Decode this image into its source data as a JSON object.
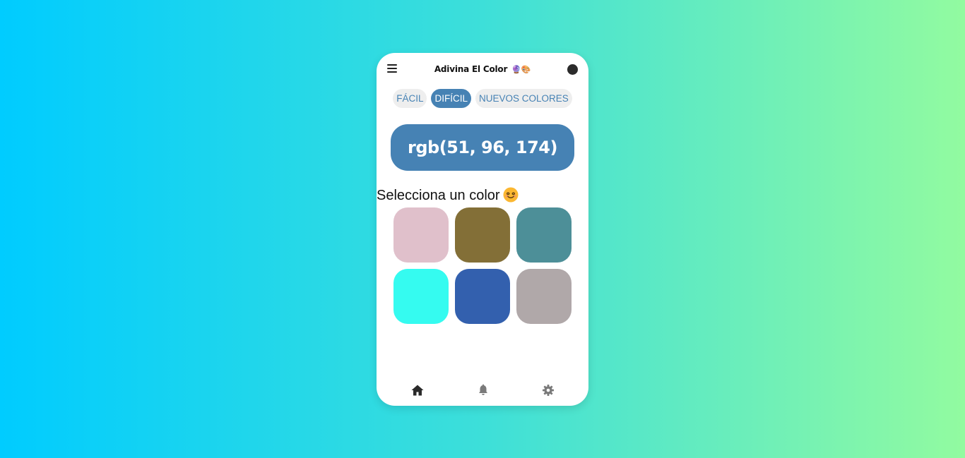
{
  "header": {
    "menu_icon": "hamburger-menu-icon",
    "title": "Adivina El Color",
    "title_emoji": "🔮🎨",
    "theme_toggle_icon": "dark-mode-dot-icon"
  },
  "tabs": [
    {
      "label": "FÁCIL",
      "active": false
    },
    {
      "label": "DIFÍCIL",
      "active": true
    },
    {
      "label": "NUEVOS COLORES",
      "active": false
    }
  ],
  "target_color": {
    "label": "rgb(51, 96, 174)"
  },
  "prompt": {
    "text": "Selecciona un color",
    "emoji": "smiling-face-icon"
  },
  "swatches": [
    {
      "color": "#e0c0cb"
    },
    {
      "color": "#836f37"
    },
    {
      "color": "#4d8f98"
    },
    {
      "color": "#35fbf0"
    },
    {
      "color": "#3360ae"
    },
    {
      "color": "#b0a8a9"
    }
  ],
  "bottom_nav": [
    {
      "name": "home",
      "icon": "home-icon",
      "active": true
    },
    {
      "name": "notifications",
      "icon": "bell-icon",
      "active": false
    },
    {
      "name": "settings",
      "icon": "gear-icon",
      "active": false
    }
  ],
  "colors": {
    "accent": "#4682b4",
    "tab_bg": "#eeeeee",
    "background_start": "#00ccff",
    "background_end": "#92fba0"
  }
}
